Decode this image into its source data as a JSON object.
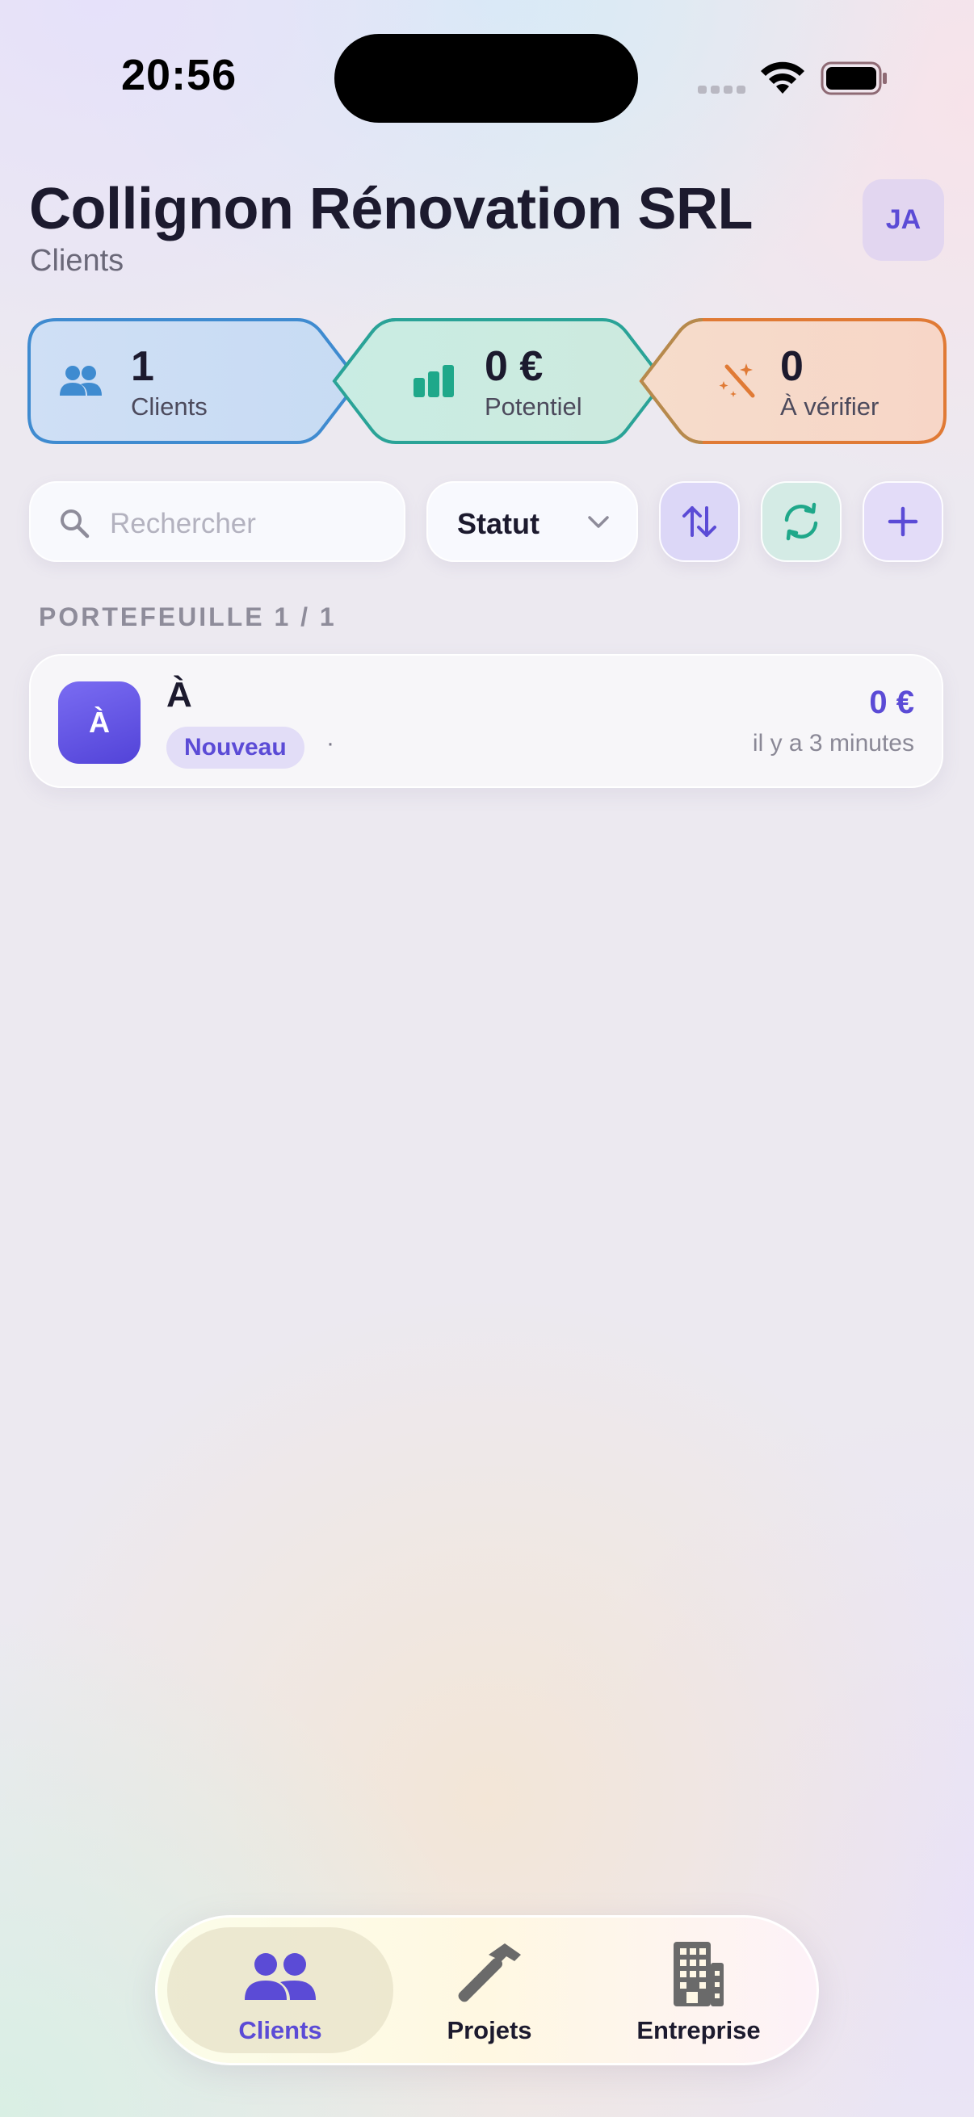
{
  "status_bar": {
    "time": "20:56"
  },
  "header": {
    "title": "Collignon Rénovation SRL",
    "subtitle": "Clients",
    "avatar_initials": "JA"
  },
  "stats": [
    {
      "icon": "users-icon",
      "value": "1",
      "label": "Clients",
      "color": "#3f8bd0"
    },
    {
      "icon": "bar-chart-icon",
      "value": "0 €",
      "label": "Potentiel",
      "color": "#1fa88a"
    },
    {
      "icon": "magic-wand-icon",
      "value": "0",
      "label": "À vérifier",
      "color": "#e07a35"
    }
  ],
  "toolbar": {
    "search_placeholder": "Rechercher",
    "status_filter": "Statut",
    "sort_icon": "sort-icon",
    "refresh_icon": "refresh-icon",
    "add_icon": "plus-icon"
  },
  "section": {
    "label": "PORTEFEUILLE 1 / 1"
  },
  "clients": [
    {
      "initial": "À",
      "name": "À",
      "status": "Nouveau",
      "separator": "·",
      "amount": "0 €",
      "updated": "il y a 3 minutes"
    }
  ],
  "tabs": [
    {
      "label": "Clients",
      "icon": "users-icon",
      "active": true
    },
    {
      "label": "Projets",
      "icon": "hammer-icon",
      "active": false
    },
    {
      "label": "Entreprise",
      "icon": "building-icon",
      "active": false
    }
  ],
  "colors": {
    "accent": "#5b4bd6",
    "text": "#1c1a2e",
    "blue": "#3f8bd0",
    "teal": "#1fa88a",
    "orange": "#e07a35"
  }
}
